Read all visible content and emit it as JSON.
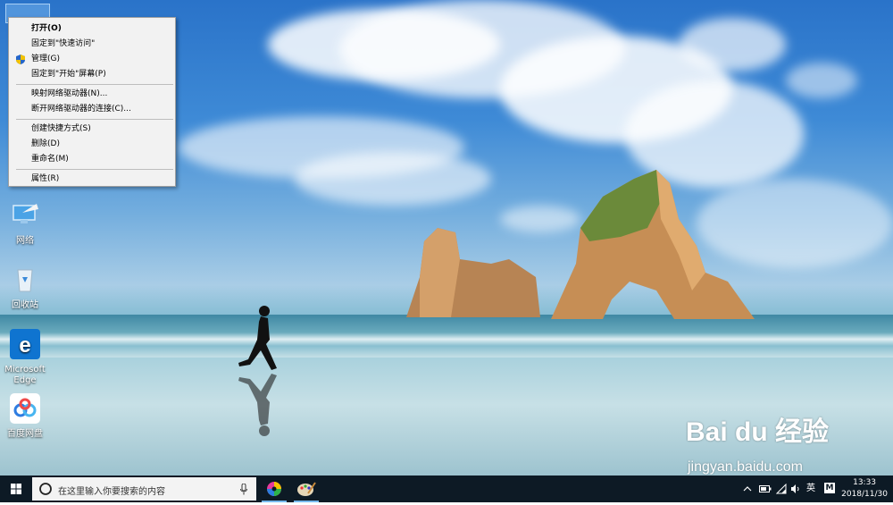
{
  "context_menu": {
    "items": [
      {
        "label": "打开(O)",
        "bold": true
      },
      {
        "label": "固定到\"快速访问\""
      },
      {
        "label": "管理(G)",
        "shield": true
      },
      {
        "label": "固定到\"开始\"屏幕(P)"
      },
      {
        "label": "映射网络驱动器(N)..."
      },
      {
        "label": "断开网络驱动器的连接(C)..."
      },
      {
        "label": "创建快捷方式(S)"
      },
      {
        "label": "删除(D)"
      },
      {
        "label": "重命名(M)"
      },
      {
        "label": "属性(R)"
      }
    ]
  },
  "desktop_icons": [
    {
      "label": "网络"
    },
    {
      "label": "回收站"
    },
    {
      "label": "Microsoft Edge"
    },
    {
      "label": "百度网盘"
    }
  ],
  "taskbar": {
    "search_placeholder": "在这里输入你要搜索的内容",
    "tray_language": "英",
    "tray_ime": "M",
    "time": "13:33",
    "date": "2018/11/30"
  },
  "watermark": {
    "brand": "Bai du 经验",
    "url": "jingyan.baidu.com"
  },
  "colors": {
    "taskbar": "#0d1a25",
    "menu_bg": "#f2f2f2",
    "accent": "#76b9ed"
  }
}
